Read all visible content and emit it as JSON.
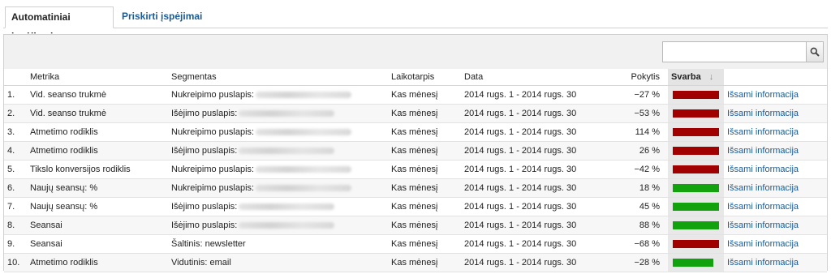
{
  "tabs": [
    {
      "label": "Automatiniai įspėjimai"
    },
    {
      "label": "Priskirti įspėjimai"
    }
  ],
  "search": {
    "placeholder": ""
  },
  "columns": {
    "metrika": "Metrika",
    "segmentas": "Segmentas",
    "laikotarpis": "Laikotarpis",
    "data": "Data",
    "pokytis": "Pokytis",
    "svarba": "Svarba",
    "sort_arrow": "↓"
  },
  "colors": {
    "high": "#a10000",
    "low": "#12a20e"
  },
  "rows": [
    {
      "idx": "1.",
      "metrika": "Vid. seanso trukmė",
      "segmentas": "Nukreipimo puslapis:",
      "segmentas_blur": true,
      "laikotarpis": "Kas mėnesį",
      "data": "2014 rugs. 1 - 2014 rugs. 30",
      "pokytis": "−27 %",
      "svarba_level": "high",
      "svarba_fill": 1.0,
      "link": "Išsami informacija"
    },
    {
      "idx": "2.",
      "metrika": "Vid. seanso trukmė",
      "segmentas": "Išėjimo puslapis:",
      "segmentas_blur": true,
      "laikotarpis": "Kas mėnesį",
      "data": "2014 rugs. 1 - 2014 rugs. 30",
      "pokytis": "−53 %",
      "svarba_level": "high",
      "svarba_fill": 1.0,
      "link": "Išsami informacija"
    },
    {
      "idx": "3.",
      "metrika": "Atmetimo rodiklis",
      "segmentas": "Nukreipimo puslapis:",
      "segmentas_blur": true,
      "laikotarpis": "Kas mėnesį",
      "data": "2014 rugs. 1 - 2014 rugs. 30",
      "pokytis": "114 %",
      "svarba_level": "high",
      "svarba_fill": 1.0,
      "link": "Išsami informacija"
    },
    {
      "idx": "4.",
      "metrika": "Atmetimo rodiklis",
      "segmentas": "Išėjimo puslapis:",
      "segmentas_blur": true,
      "laikotarpis": "Kas mėnesį",
      "data": "2014 rugs. 1 - 2014 rugs. 30",
      "pokytis": "26 %",
      "svarba_level": "high",
      "svarba_fill": 1.0,
      "link": "Išsami informacija"
    },
    {
      "idx": "5.",
      "metrika": "Tikslo konversijos rodiklis",
      "segmentas": "Nukreipimo puslapis:",
      "segmentas_blur": true,
      "laikotarpis": "Kas mėnesį",
      "data": "2014 rugs. 1 - 2014 rugs. 30",
      "pokytis": "−42 %",
      "svarba_level": "high",
      "svarba_fill": 1.0,
      "link": "Išsami informacija"
    },
    {
      "idx": "6.",
      "metrika": "Naujų seansų: %",
      "segmentas": "Nukreipimo puslapis:",
      "segmentas_blur": true,
      "laikotarpis": "Kas mėnesį",
      "data": "2014 rugs. 1 - 2014 rugs. 30",
      "pokytis": "18 %",
      "svarba_level": "low",
      "svarba_fill": 1.0,
      "link": "Išsami informacija"
    },
    {
      "idx": "7.",
      "metrika": "Naujų seansų: %",
      "segmentas": "Išėjimo puslapis:",
      "segmentas_blur": true,
      "laikotarpis": "Kas mėnesį",
      "data": "2014 rugs. 1 - 2014 rugs. 30",
      "pokytis": "45 %",
      "svarba_level": "low",
      "svarba_fill": 1.0,
      "link": "Išsami informacija"
    },
    {
      "idx": "8.",
      "metrika": "Seansai",
      "segmentas": "Išėjimo puslapis:",
      "segmentas_blur": true,
      "laikotarpis": "Kas mėnesį",
      "data": "2014 rugs. 1 - 2014 rugs. 30",
      "pokytis": "88 %",
      "svarba_level": "low",
      "svarba_fill": 1.0,
      "link": "Išsami informacija"
    },
    {
      "idx": "9.",
      "metrika": "Seansai",
      "segmentas": "Šaltinis: newsletter",
      "segmentas_blur": false,
      "laikotarpis": "Kas mėnesį",
      "data": "2014 rugs. 1 - 2014 rugs. 30",
      "pokytis": "−68 %",
      "svarba_level": "high",
      "svarba_fill": 1.0,
      "link": "Išsami informacija"
    },
    {
      "idx": "10.",
      "metrika": "Atmetimo rodiklis",
      "segmentas": "Vidutinis: email",
      "segmentas_blur": false,
      "laikotarpis": "Kas mėnesį",
      "data": "2014 rugs. 1 - 2014 rugs. 30",
      "pokytis": "−28 %",
      "svarba_level": "low",
      "svarba_fill": 0.88,
      "link": "Išsami informacija"
    }
  ]
}
